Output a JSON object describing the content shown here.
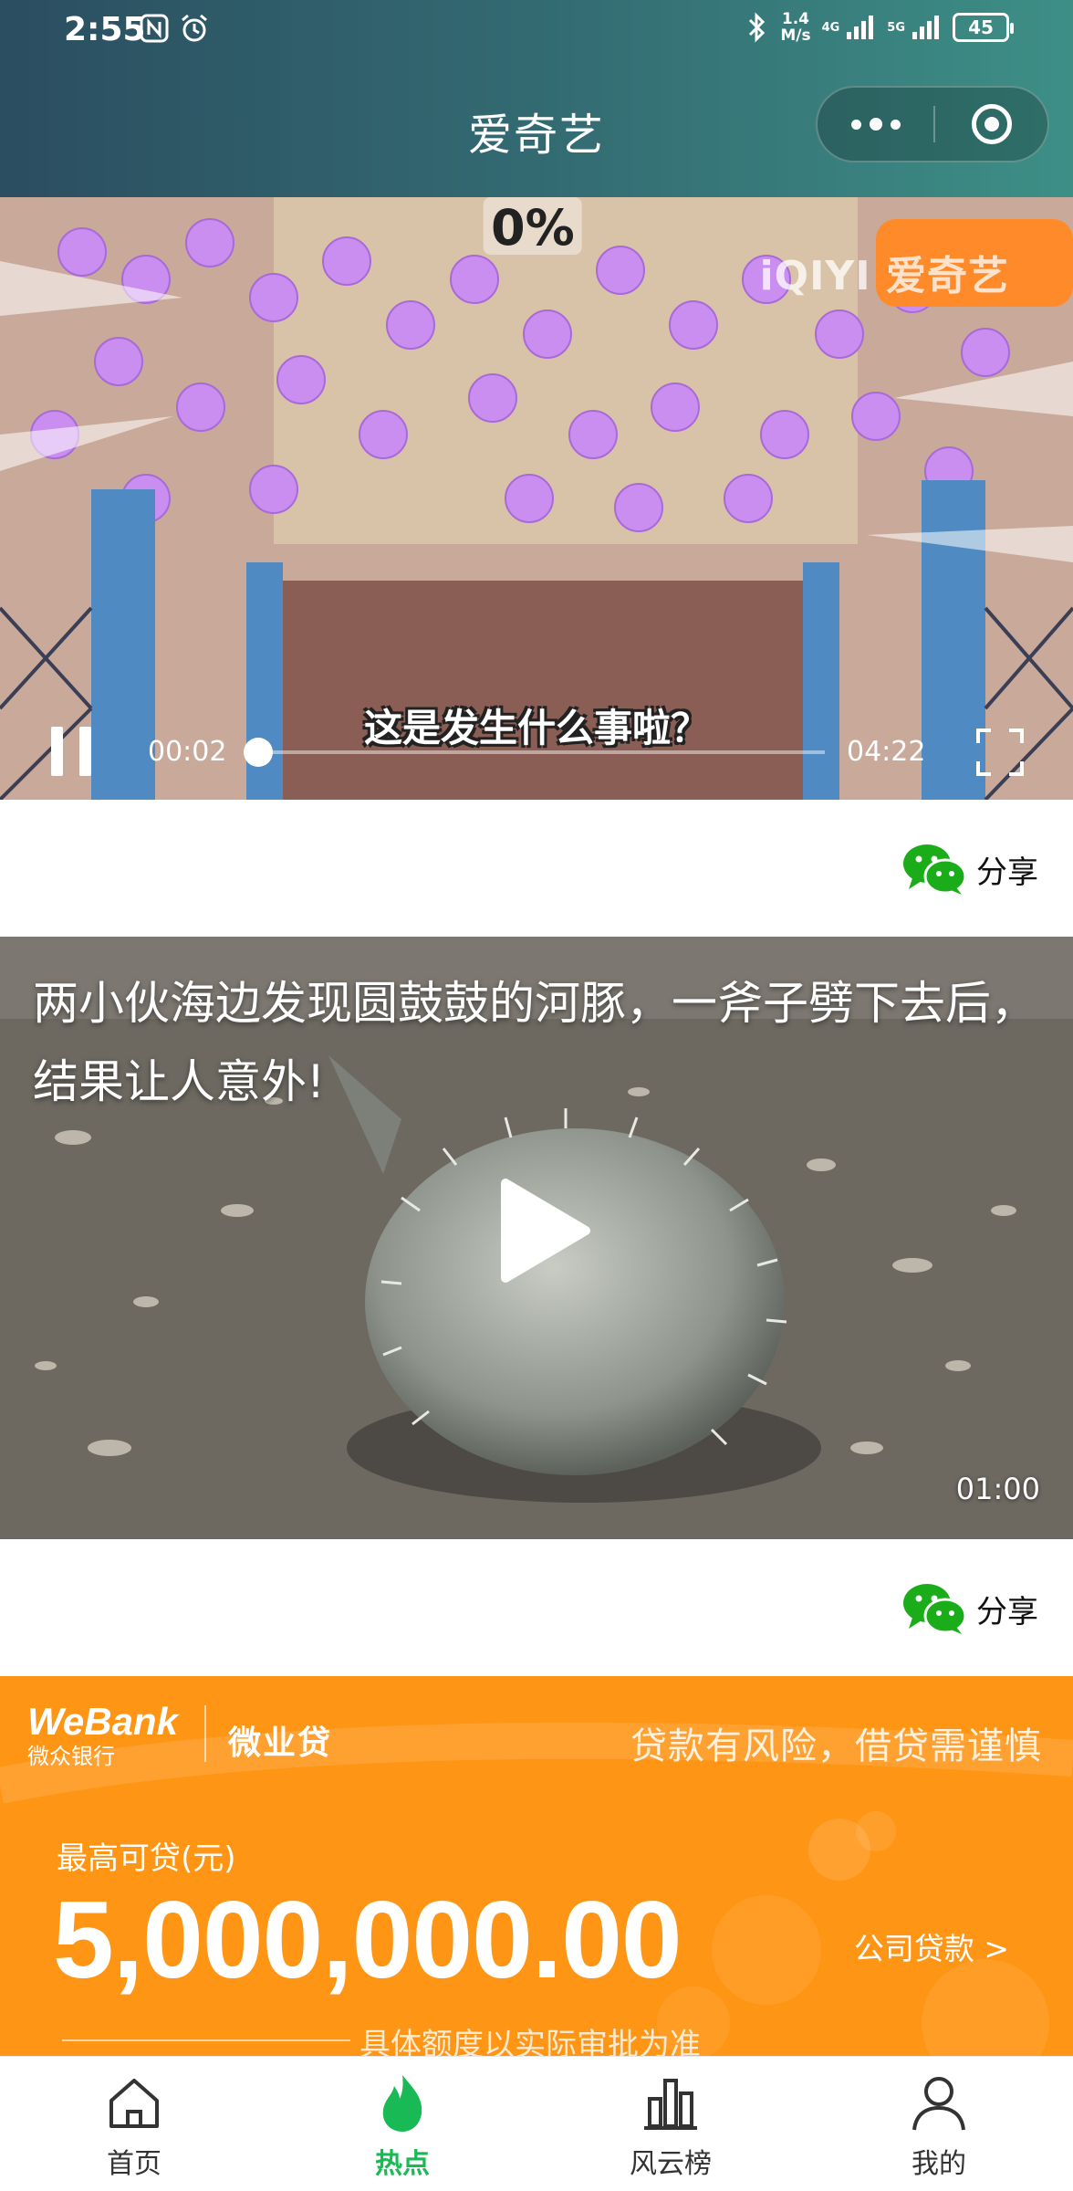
{
  "status_bar": {
    "time": "2:55",
    "net_speed_value": "1.4",
    "net_speed_unit": "M/s",
    "signal1_label": "4G",
    "signal2_label": "5G",
    "battery_level": "45"
  },
  "header": {
    "title": "爱奇艺",
    "more_icon": "more-dots-icon",
    "close_icon": "target-close-icon"
  },
  "video1": {
    "watermark": "iQIYI 爱奇艺",
    "overlay_text": "%0",
    "subtitle": "这是发生什么事啦？",
    "current_time": "00:02",
    "total_time": "04:22",
    "progress": 0.008,
    "state": "playing"
  },
  "share1": {
    "label": "分享",
    "icon": "wechat-icon"
  },
  "video2": {
    "title": "两小伙海边发现圆鼓鼓的河豚，一斧子劈下去后，结果让人意外!",
    "duration": "01:00",
    "play_icon": "play-icon"
  },
  "share2": {
    "label": "分享",
    "icon": "wechat-icon"
  },
  "ad": {
    "bank_name_en": "WeBank",
    "bank_name_cn": "微众银行",
    "product": "微业贷",
    "risk_warning": "贷款有风险，借贷需谨慎",
    "max_label": "最高可贷(元)",
    "amount": "5,000,000.00",
    "company_link": "公司贷款 >",
    "approval_note": "具体额度以实际审批为准",
    "accent_color": "#ff9514"
  },
  "bottom_nav": {
    "items": [
      {
        "label": "首页",
        "icon": "home-icon",
        "active": false
      },
      {
        "label": "热点",
        "icon": "flame-icon",
        "active": true
      },
      {
        "label": "风云榜",
        "icon": "ranking-chart-icon",
        "active": false
      },
      {
        "label": "我的",
        "icon": "user-icon",
        "active": false
      }
    ],
    "active_color": "#19b955"
  }
}
